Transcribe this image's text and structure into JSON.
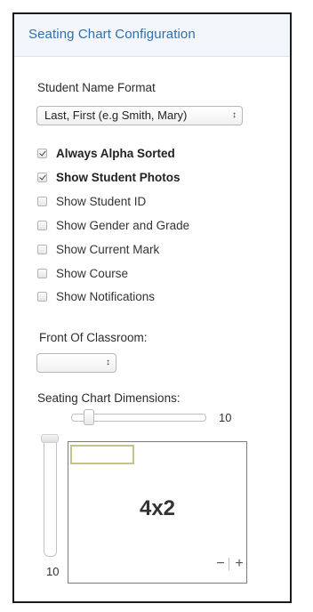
{
  "panel": {
    "title": "Seating Chart Configuration"
  },
  "name_format": {
    "label": "Student Name Format",
    "selected": "Last, First (e.g Smith, Mary)",
    "arrows": "↕"
  },
  "options": [
    {
      "label": "Always Alpha Sorted",
      "checked": true
    },
    {
      "label": "Show Student Photos",
      "checked": true
    },
    {
      "label": "Show Student ID",
      "checked": false
    },
    {
      "label": "Show Gender and Grade",
      "checked": false
    },
    {
      "label": "Show Current Mark",
      "checked": false
    },
    {
      "label": "Show Course",
      "checked": false
    },
    {
      "label": "Show Notifications",
      "checked": false
    }
  ],
  "front_of_classroom": {
    "label": "Front Of Classroom:",
    "selected": "",
    "arrows": "↕"
  },
  "dimensions": {
    "label": "Seating Chart Dimensions:",
    "columns_value": "10",
    "rows_value": "10",
    "grid_label": "4x2",
    "zoom_out": "−",
    "zoom_in": "+"
  }
}
